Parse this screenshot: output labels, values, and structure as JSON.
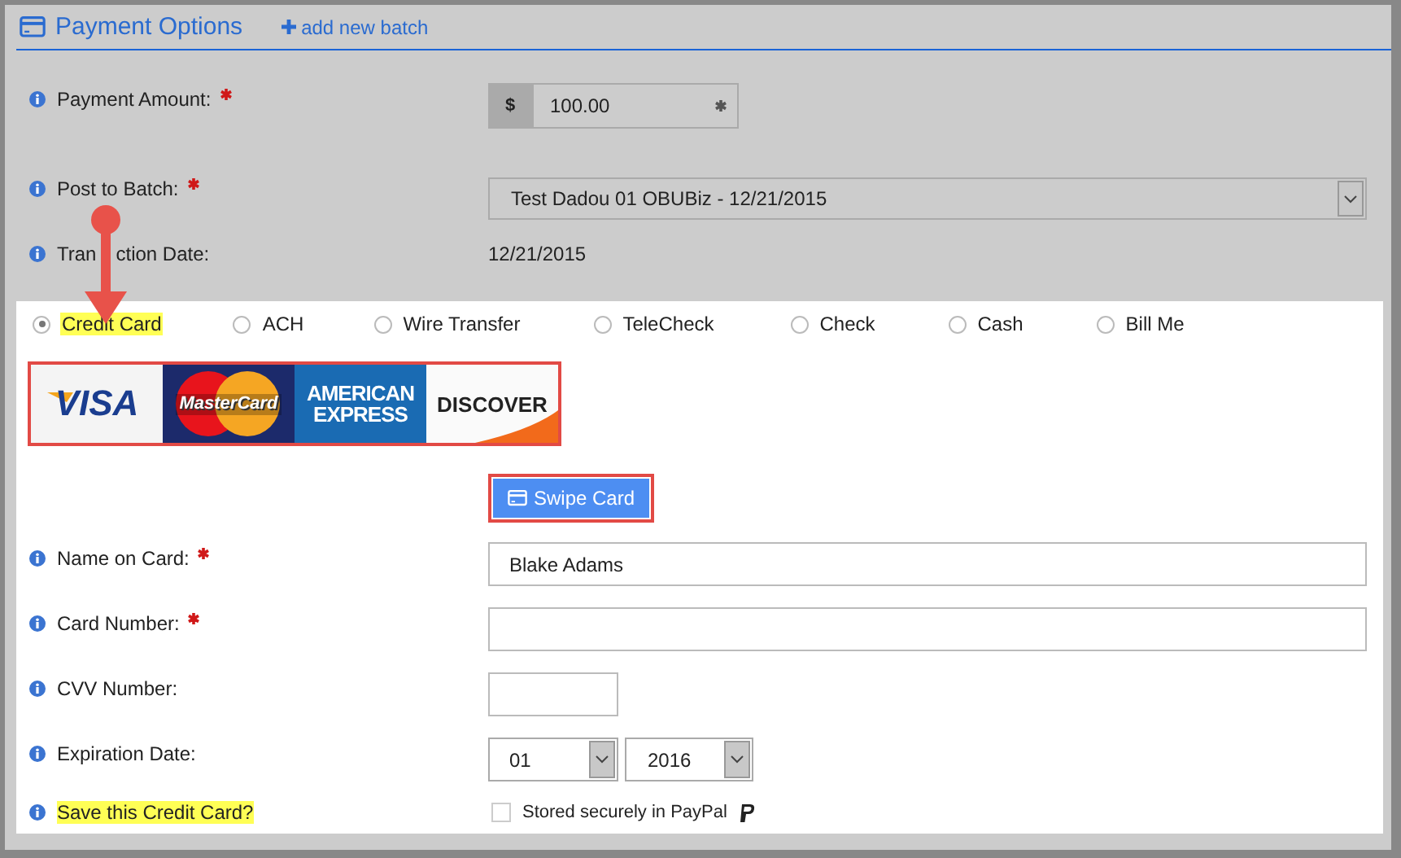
{
  "header": {
    "title": "Payment Options",
    "link": "add new batch"
  },
  "amount": {
    "label": "Payment Amount:",
    "required": true,
    "currency": "$",
    "value": "100.00"
  },
  "batch": {
    "label": "Post to Batch:",
    "required": true,
    "value": "Test Dadou 01 OBUBiz - 12/21/2015"
  },
  "transaction_date": {
    "label_start": "Tran",
    "label_end": "ction Date:",
    "value": "12/21/2015"
  },
  "methods": [
    {
      "label": "Credit Card",
      "selected": true,
      "highlighted": true
    },
    {
      "label": "ACH",
      "selected": false,
      "highlighted": false
    },
    {
      "label": "Wire Transfer",
      "selected": false,
      "highlighted": false
    },
    {
      "label": "TeleCheck",
      "selected": false,
      "highlighted": false
    },
    {
      "label": "Check",
      "selected": false,
      "highlighted": false
    },
    {
      "label": "Cash",
      "selected": false,
      "highlighted": false
    },
    {
      "label": "Bill Me",
      "selected": false,
      "highlighted": false
    }
  ],
  "card_logos": {
    "outlined": true,
    "items": [
      {
        "kind": "visa",
        "text": "VISA"
      },
      {
        "kind": "mastercard",
        "text": "MasterCard"
      },
      {
        "kind": "amex",
        "text": "AMERICAN EXPRESS"
      },
      {
        "kind": "discover",
        "text": "DISCOVER"
      }
    ]
  },
  "swipe_button": {
    "label": "Swipe Card",
    "outlined": true
  },
  "fields": [
    {
      "kind": "text",
      "label": "Name on Card:",
      "required": true,
      "value": "Blake Adams"
    },
    {
      "kind": "text",
      "label": "Card Number:",
      "required": true
    },
    {
      "kind": "short",
      "label": "CVV Number:",
      "required": false
    },
    {
      "kind": "expiry",
      "label": "Expiration Date:",
      "required": false,
      "month": "01",
      "year": "2016"
    },
    {
      "kind": "checkbox",
      "label": "Save this Credit Card?",
      "required": false,
      "highlighted": true,
      "checked": false,
      "text": "Stored securely in PayPal"
    }
  ]
}
